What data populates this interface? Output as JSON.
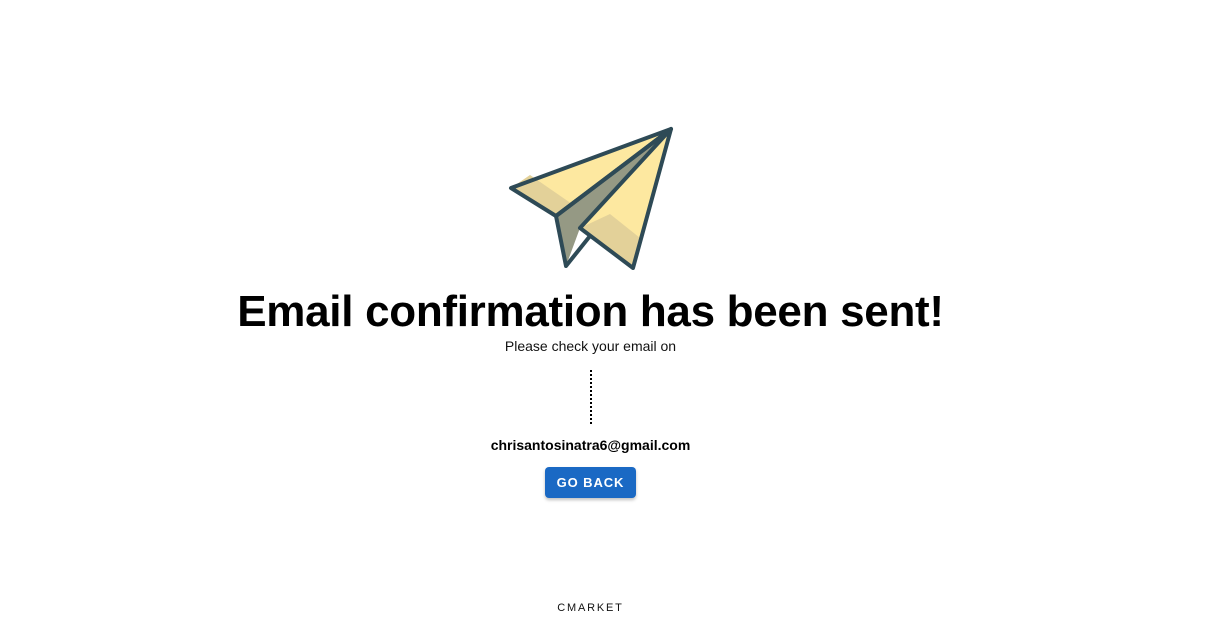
{
  "confirmation": {
    "title": "Email confirmation has been sent!",
    "subtitle": "Please check your email on",
    "email": "chrisantosinatra6@gmail.com",
    "button_label": "GO BACK"
  },
  "footer": {
    "brand": "CMARKET"
  },
  "icons": {
    "hero": "paper-plane-icon"
  },
  "colors": {
    "button": "#1a69c4",
    "plane_light": "#fde8a0",
    "plane_mid": "#e3d199",
    "plane_dark": "#959984",
    "plane_outline": "#2e4a56"
  }
}
